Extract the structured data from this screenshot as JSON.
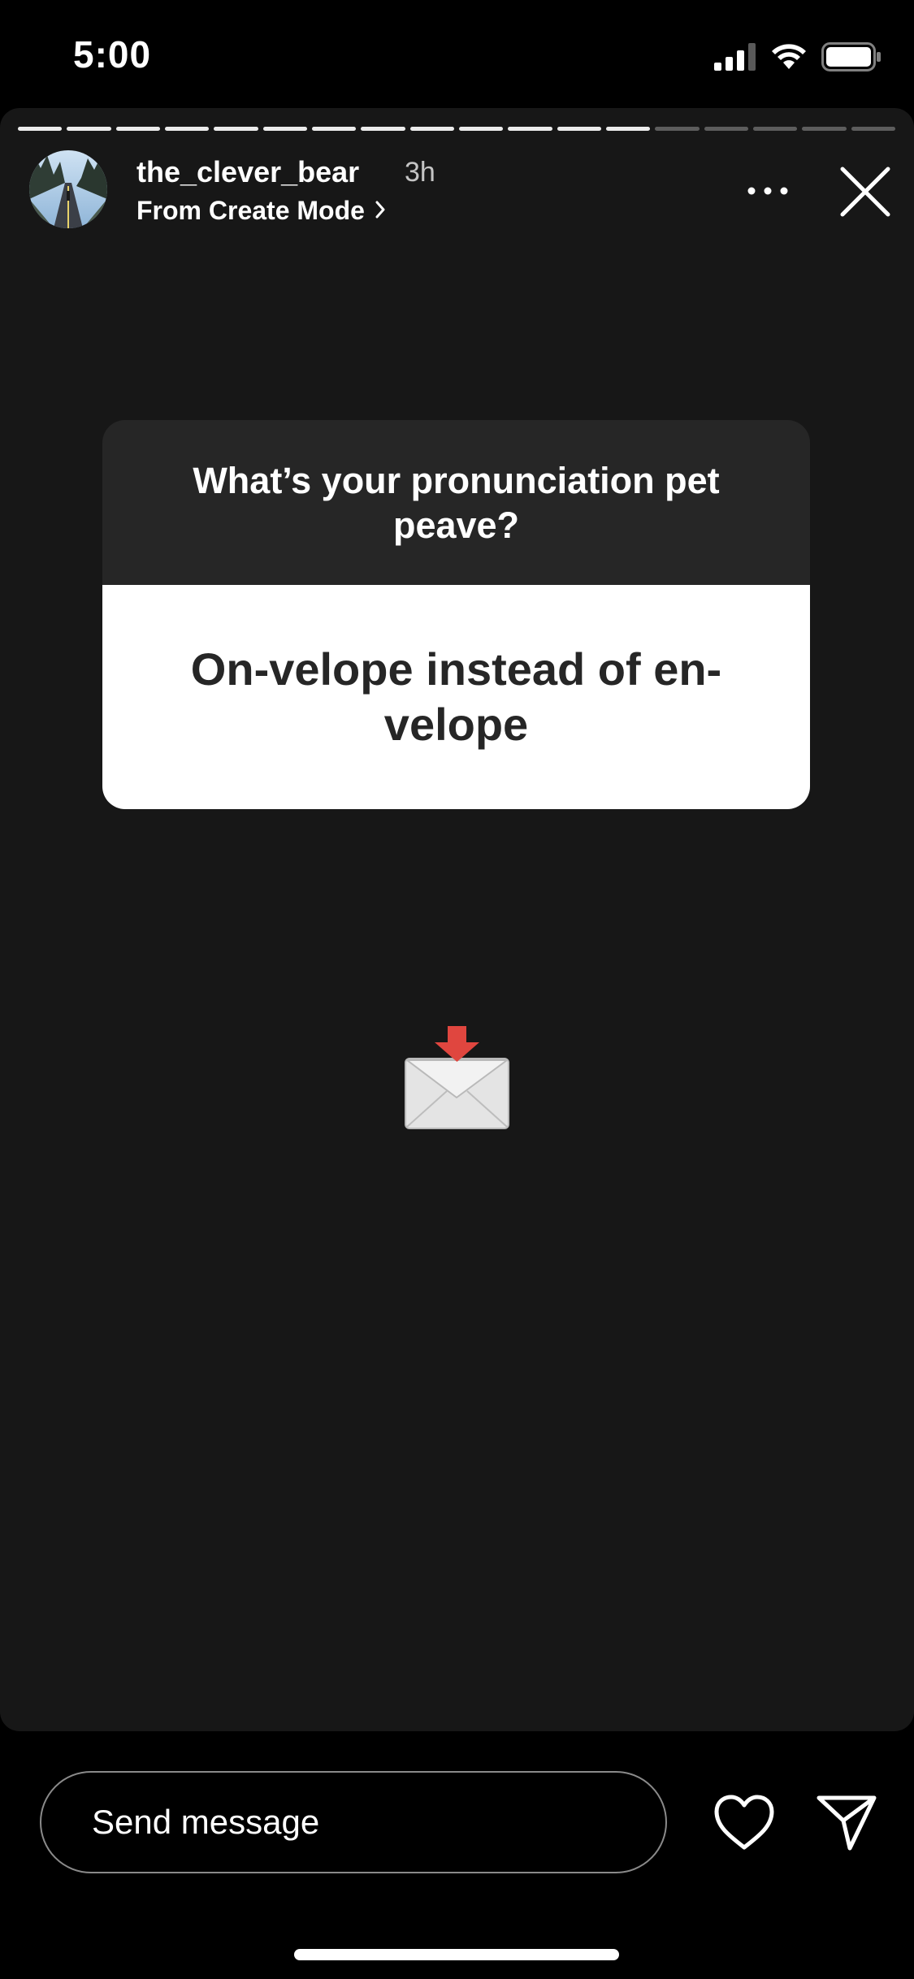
{
  "status_bar": {
    "time": "5:00",
    "icons": [
      "cellular-signal-icon",
      "wifi-icon",
      "battery-icon"
    ]
  },
  "story": {
    "progress": {
      "total_segments": 18,
      "completed_segments": 13
    },
    "header": {
      "username": "the_clever_bear",
      "time_ago": "3h",
      "source_label": "From Create Mode",
      "source_chevron": "›"
    },
    "question_sticker": {
      "question": "What’s your pronunciation pet peave?",
      "answer": "On-velope instead of en-velope"
    },
    "emoji": "envelope-with-arrow"
  },
  "bottom_bar": {
    "message_placeholder": "Send message"
  },
  "colors": {
    "background": "#000000",
    "story_background": "#171717",
    "sticker_header": "#262626",
    "sticker_body": "#ffffff",
    "answer_text": "#262626"
  }
}
